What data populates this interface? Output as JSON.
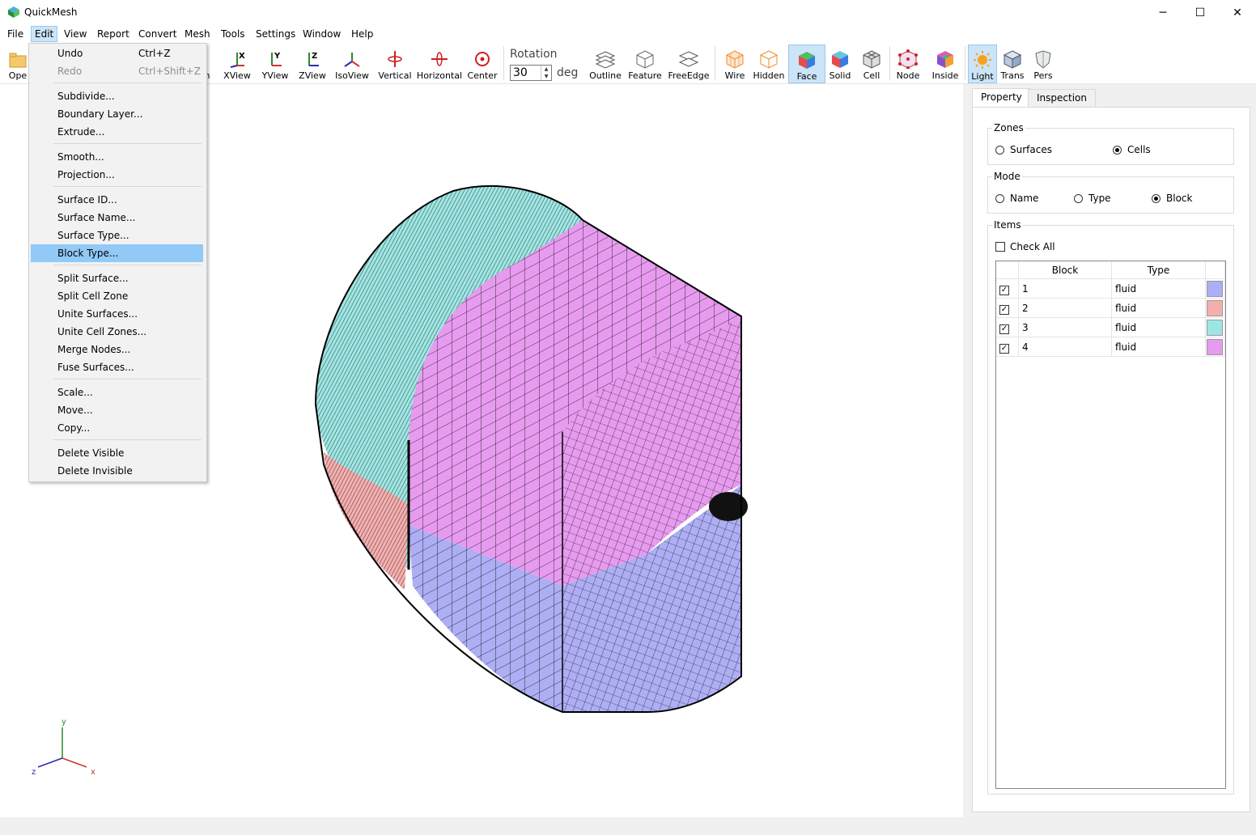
{
  "window": {
    "title": "QuickMesh",
    "minimize": "─",
    "maximize": "☐",
    "close": "✕"
  },
  "menubar": [
    "File",
    "Edit",
    "View",
    "Report",
    "Convert",
    "Mesh",
    "Tools",
    "Settings",
    "Window",
    "Help"
  ],
  "toolbar": {
    "open_partial": "Ope",
    "hidden_partial": "n",
    "buttons": [
      "XView",
      "YView",
      "ZView",
      "IsoView",
      "Vertical",
      "Horizontal",
      "Center",
      "Outline",
      "Feature",
      "FreeEdge",
      "Wire",
      "Hidden",
      "Face",
      "Solid",
      "Cell",
      "Node",
      "Inside",
      "Light",
      "Trans",
      "Pers"
    ],
    "selected": [
      "Face",
      "Light"
    ],
    "rotation_label": "Rotation",
    "rotation_value": "30",
    "rotation_unit": "deg"
  },
  "edit_menu": {
    "items": [
      {
        "label": "Undo",
        "shortcut": "Ctrl+Z",
        "disabled": false
      },
      {
        "label": "Redo",
        "shortcut": "Ctrl+Shift+Z",
        "disabled": true
      },
      {
        "label": "Subdivide...",
        "shortcut": ""
      },
      {
        "label": "Boundary Layer...",
        "shortcut": ""
      },
      {
        "label": "Extrude...",
        "shortcut": ""
      },
      {
        "label": "Smooth...",
        "shortcut": ""
      },
      {
        "label": "Projection...",
        "shortcut": ""
      },
      {
        "label": "Surface ID...",
        "shortcut": ""
      },
      {
        "label": "Surface Name...",
        "shortcut": ""
      },
      {
        "label": "Surface Type...",
        "shortcut": ""
      },
      {
        "label": "Block Type...",
        "shortcut": "",
        "highlighted": true
      },
      {
        "label": "Split Surface...",
        "shortcut": ""
      },
      {
        "label": "Split Cell Zone",
        "shortcut": ""
      },
      {
        "label": "Unite Surfaces...",
        "shortcut": ""
      },
      {
        "label": "Unite Cell Zones...",
        "shortcut": ""
      },
      {
        "label": "Merge Nodes...",
        "shortcut": ""
      },
      {
        "label": "Fuse Surfaces...",
        "shortcut": ""
      },
      {
        "label": "Scale...",
        "shortcut": ""
      },
      {
        "label": "Move...",
        "shortcut": ""
      },
      {
        "label": "Copy...",
        "shortcut": ""
      },
      {
        "label": "Delete Visible",
        "shortcut": ""
      },
      {
        "label": "Delete Invisible",
        "shortcut": ""
      }
    ]
  },
  "panel": {
    "tabs": [
      "Property",
      "Inspection"
    ],
    "active_tab": "Property",
    "zones": {
      "title": "Zones",
      "options": [
        "Surfaces",
        "Cells"
      ],
      "selected": "Cells"
    },
    "mode": {
      "title": "Mode",
      "options": [
        "Name",
        "Type",
        "Block"
      ],
      "selected": "Block"
    },
    "items": {
      "title": "Items",
      "check_all": "Check All",
      "columns": [
        "Block",
        "Type"
      ],
      "rows": [
        {
          "block": "1",
          "type": "fluid",
          "color": "#aeaef5",
          "checked": true
        },
        {
          "block": "2",
          "type": "fluid",
          "color": "#f5aeae",
          "checked": true
        },
        {
          "block": "3",
          "type": "fluid",
          "color": "#9ee6e3",
          "checked": true
        },
        {
          "block": "4",
          "type": "fluid",
          "color": "#e79bef",
          "checked": true
        }
      ]
    }
  },
  "axes": {
    "y": "y",
    "x": "x",
    "z": "z"
  },
  "colors": {
    "block1": "#aeaef5",
    "block2": "#f5aeae",
    "block3": "#9ee6e3",
    "block4": "#e79bef",
    "menu_highlight": "#91c9f7"
  }
}
